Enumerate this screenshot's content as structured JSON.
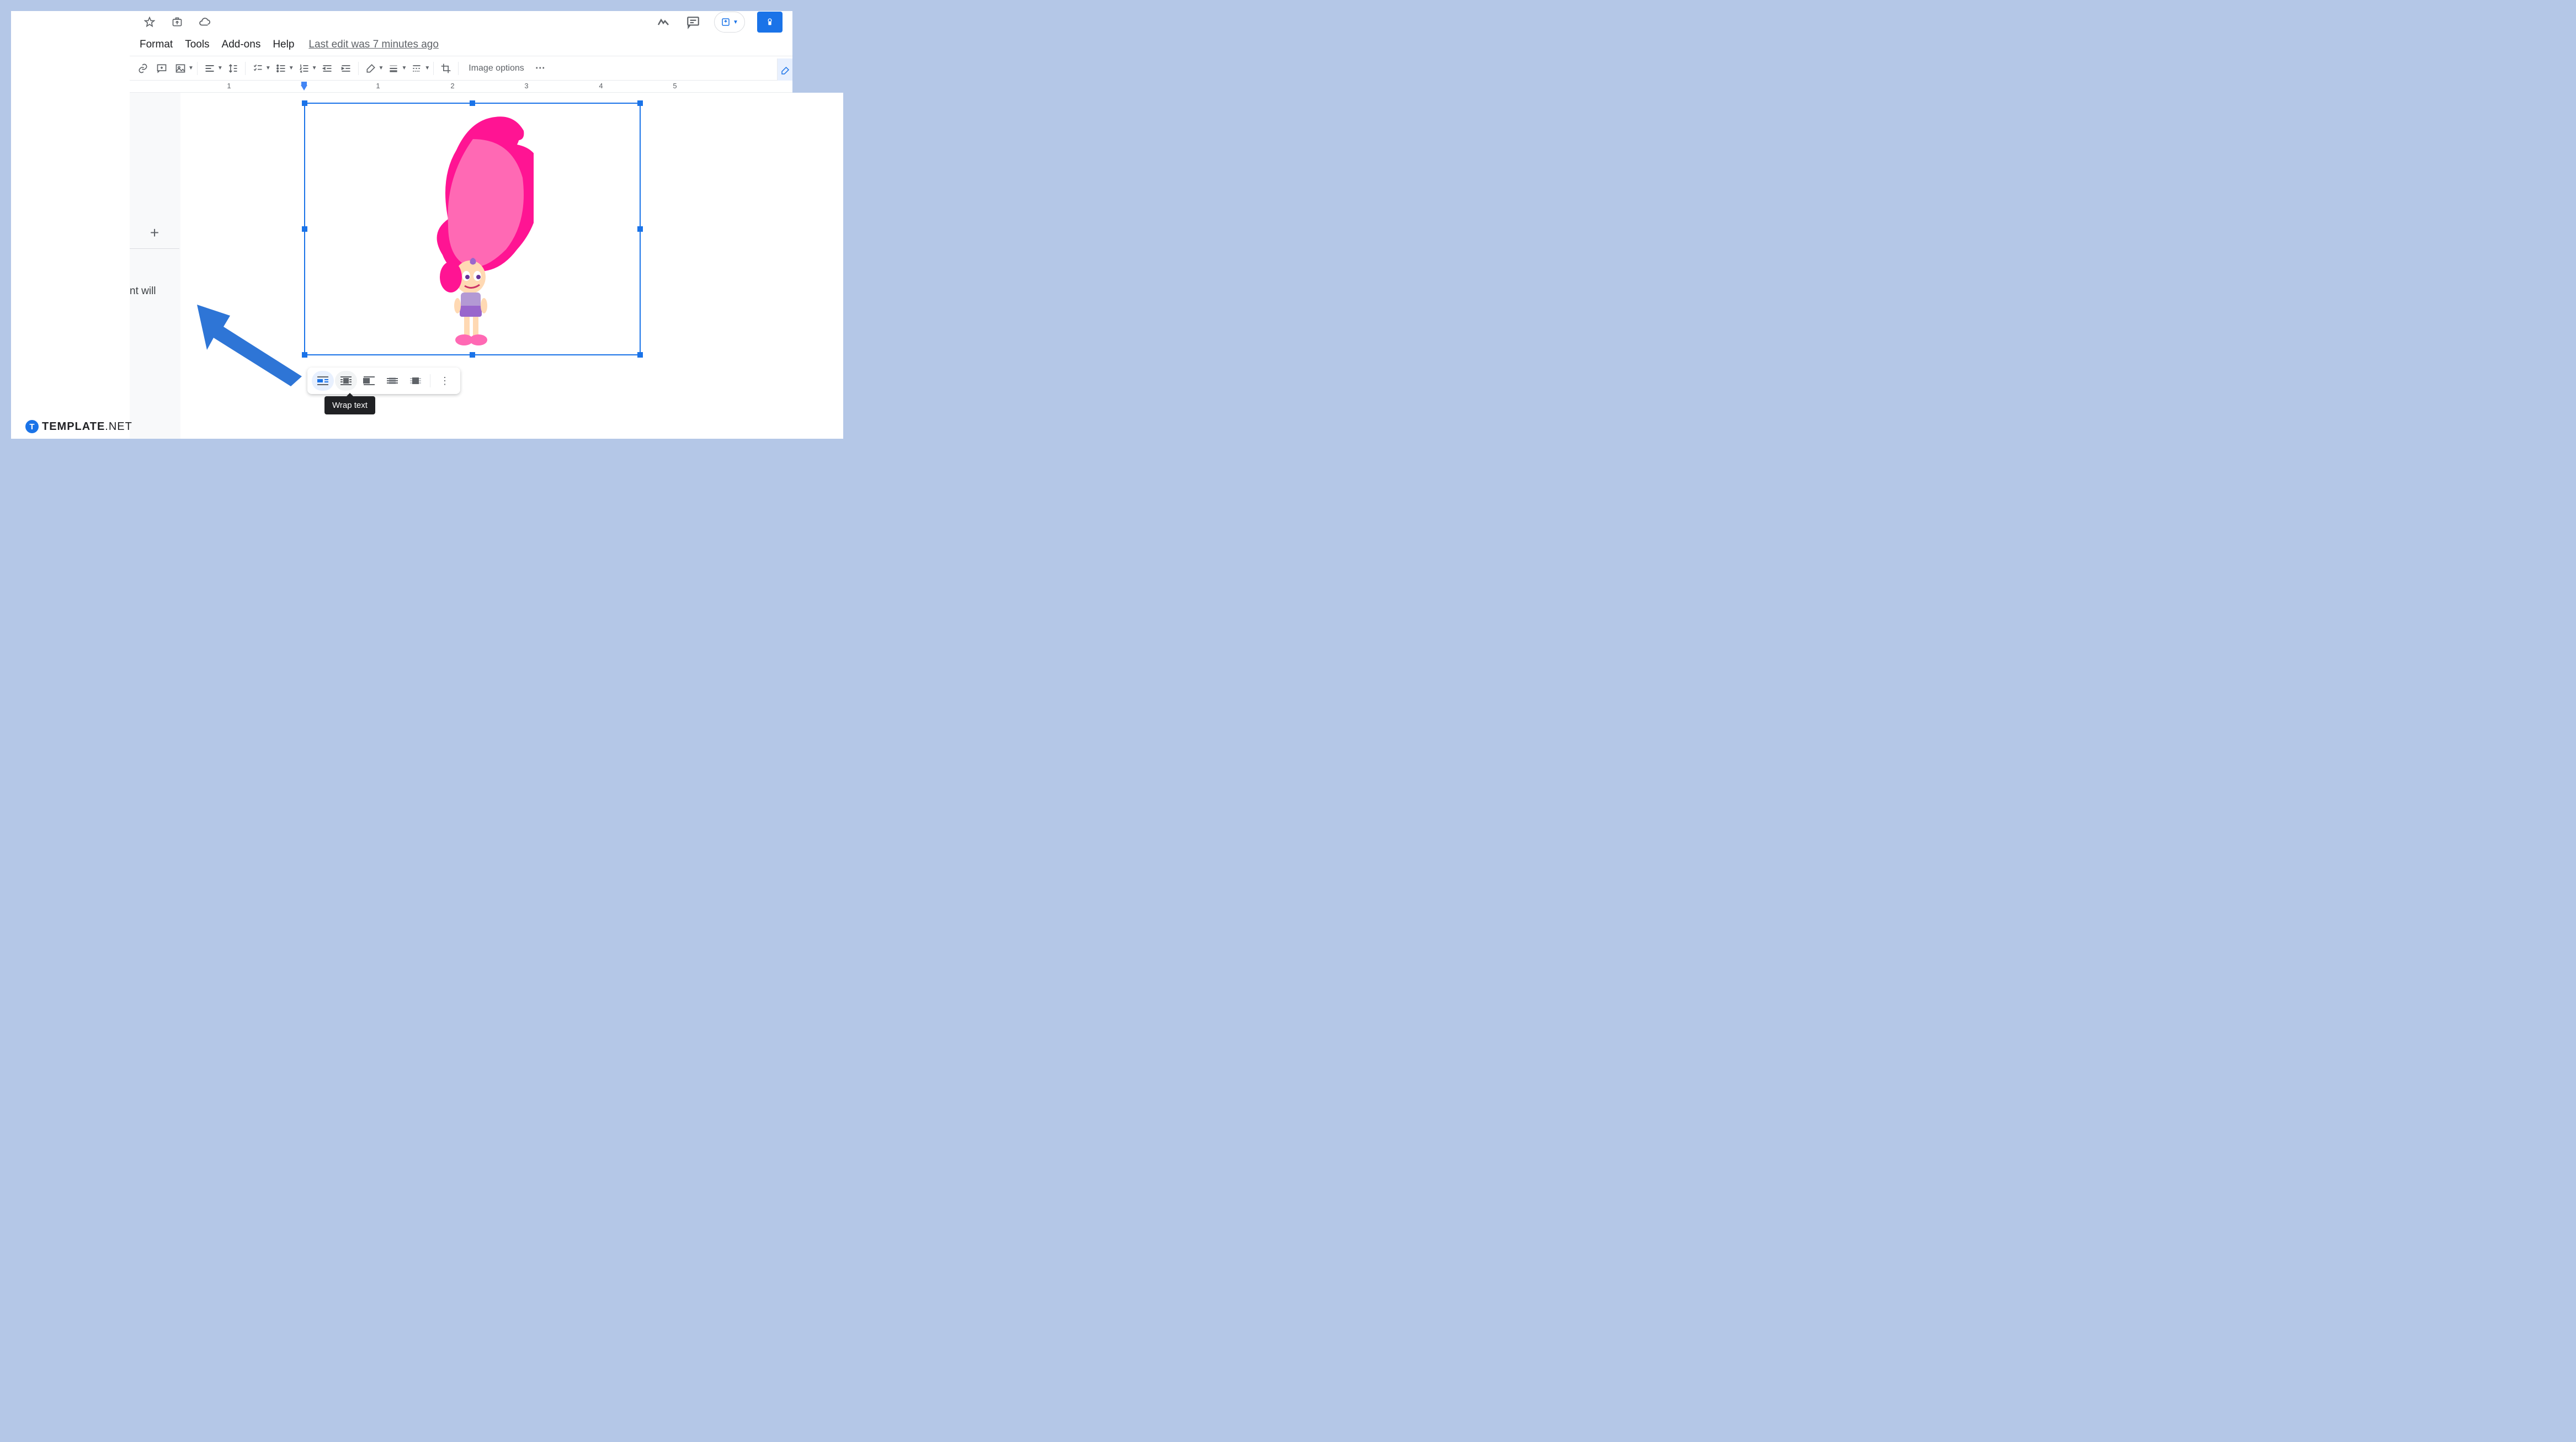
{
  "menubar": {
    "format": "Format",
    "tools": "Tools",
    "addons": "Add-ons",
    "help": "Help",
    "last_edit": "Last edit was 7 minutes ago"
  },
  "toolbar": {
    "image_options": "Image options"
  },
  "ruler": {
    "marks": [
      "1",
      "1",
      "2",
      "3",
      "4",
      "5"
    ]
  },
  "left_panel": {
    "fragment_text": "nt will"
  },
  "wrap_toolbar": {
    "tooltip": "Wrap text"
  },
  "watermark": {
    "brand": "TEMPLATE",
    "suffix": ".NET"
  },
  "icons": {
    "star": "star-icon",
    "move": "move-icon",
    "cloud": "cloud-status-icon",
    "activity": "activity-icon",
    "comment": "comment-icon",
    "present": "present-icon",
    "lock": "lock-icon",
    "link": "link-icon",
    "add_comment": "add-comment-icon",
    "image": "image-icon",
    "align": "align-icon",
    "line_spacing": "line-spacing-icon",
    "checklist": "checklist-icon",
    "bullets": "bulleted-list-icon",
    "numbers": "numbered-list-icon",
    "indent_dec": "decrease-indent-icon",
    "indent_inc": "increase-indent-icon",
    "border_color": "border-color-icon",
    "border_weight": "border-weight-icon",
    "border_dash": "border-dash-icon",
    "crop": "crop-icon",
    "more": "more-icon",
    "pencil": "pencil-icon",
    "plus": "plus-icon"
  }
}
